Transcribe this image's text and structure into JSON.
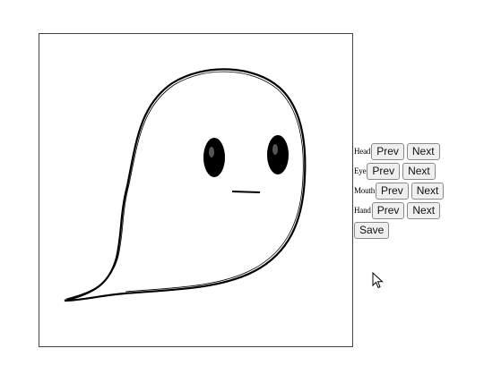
{
  "canvas": {
    "character": "ghost",
    "stroke_color": "#000000",
    "fill_color": "#ffffff"
  },
  "controls": {
    "rows": [
      {
        "label": "Head",
        "prev": "Prev",
        "next": "Next"
      },
      {
        "label": "Eye",
        "prev": "Prev",
        "next": "Next"
      },
      {
        "label": "Mouth",
        "prev": "Prev",
        "next": "Next"
      },
      {
        "label": "Hand",
        "prev": "Prev",
        "next": "Next"
      }
    ],
    "save_label": "Save"
  },
  "icons": {
    "cursor": "mouse-pointer-icon"
  }
}
